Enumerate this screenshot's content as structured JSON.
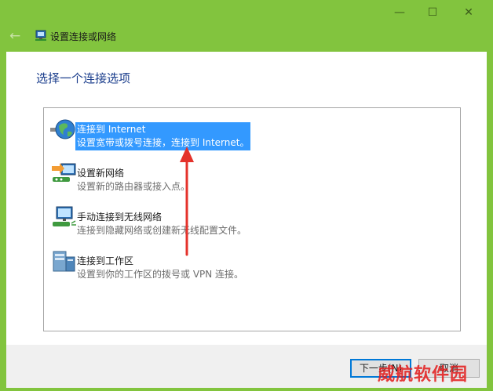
{
  "window": {
    "title": "设置连接或网络",
    "controls": {
      "minimize": "—",
      "maximize": "☐",
      "close": "✕"
    }
  },
  "back_glyph": "←",
  "heading": "选择一个连接选项",
  "options": [
    {
      "icon": "globe-network-icon",
      "title": "连接到 Internet",
      "desc": "设置宽带或拨号连接，连接到 Internet。",
      "selected": true
    },
    {
      "icon": "router-setup-icon",
      "title": "设置新网络",
      "desc": "设置新的路由器或接入点。",
      "selected": false
    },
    {
      "icon": "wireless-monitor-icon",
      "title": "手动连接到无线网络",
      "desc": "连接到隐藏网络或创建新无线配置文件。",
      "selected": false
    },
    {
      "icon": "workplace-server-icon",
      "title": "连接到工作区",
      "desc": "设置到你的工作区的拨号或 VPN 连接。",
      "selected": false
    }
  ],
  "buttons": {
    "next": "下一步(N)",
    "cancel": "取消"
  },
  "watermark": "威航软件园",
  "colors": {
    "titlebar": "#82c43e",
    "heading": "#1a3d8c",
    "selection": "#3399ff",
    "annotation_arrow": "#e4322b"
  }
}
